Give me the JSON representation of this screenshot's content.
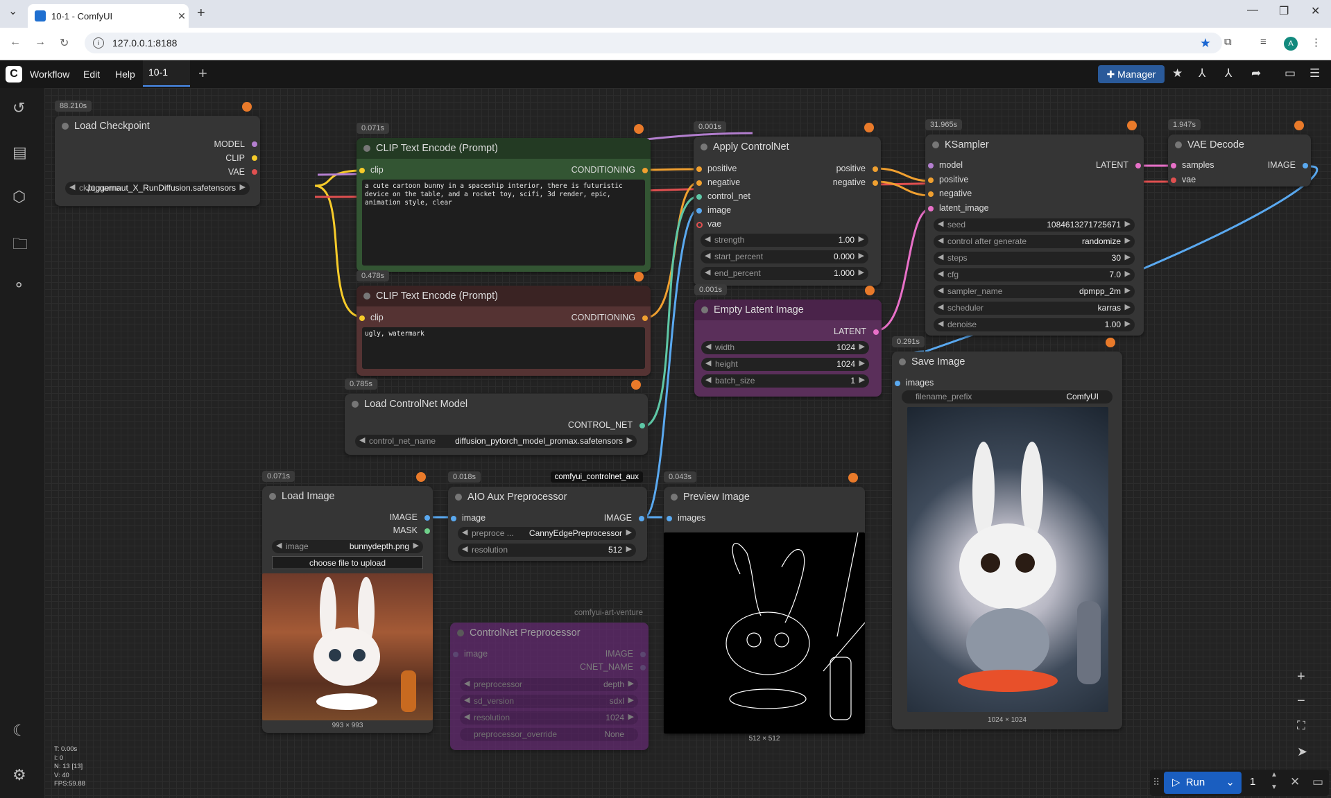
{
  "browser": {
    "tab_title": "10-1 - ComfyUI",
    "url": "127.0.0.1:8188",
    "profile_initial": "A"
  },
  "app": {
    "menus": [
      "Workflow",
      "Edit",
      "Help"
    ],
    "workflow_tab": "10-1",
    "manager_label": "Manager",
    "run_label": "Run",
    "run_count": "1",
    "accent": "#1a5ec0"
  },
  "nodes": {
    "load_checkpoint": {
      "time": "88.210s",
      "title": "Load Checkpoint",
      "outputs": [
        "MODEL",
        "CLIP",
        "VAE"
      ],
      "widget_label": "ckpt_name",
      "widget_value": "Juggernaut_X_RunDiffusion.safetensors"
    },
    "clip_pos": {
      "time": "0.071s",
      "title": "CLIP Text Encode (Prompt)",
      "input": "clip",
      "output": "CONDITIONING",
      "text": "a cute cartoon bunny in a spaceship interior, there is futuristic device on the table, and a rocket toy, scifi, 3d render, epic, animation style, clear"
    },
    "clip_neg": {
      "time": "0.478s",
      "title": "CLIP Text Encode (Prompt)",
      "input": "clip",
      "output": "CONDITIONING",
      "text": "ugly, watermark"
    },
    "apply_controlnet": {
      "time": "0.001s",
      "title": "Apply ControlNet",
      "inputs": [
        "positive",
        "negative",
        "control_net",
        "image",
        "vae"
      ],
      "outputs": [
        "positive",
        "negative"
      ],
      "widgets": [
        {
          "label": "strength",
          "value": "1.00"
        },
        {
          "label": "start_percent",
          "value": "0.000"
        },
        {
          "label": "end_percent",
          "value": "1.000"
        }
      ]
    },
    "empty_latent": {
      "time": "0.001s",
      "title": "Empty Latent Image",
      "output": "LATENT",
      "widgets": [
        {
          "label": "width",
          "value": "1024"
        },
        {
          "label": "height",
          "value": "1024"
        },
        {
          "label": "batch_size",
          "value": "1"
        }
      ]
    },
    "ksampler": {
      "time": "31.965s",
      "title": "KSampler",
      "inputs": [
        "model",
        "positive",
        "negative",
        "latent_image"
      ],
      "output": "LATENT",
      "widgets": [
        {
          "label": "seed",
          "value": "1084613271725671"
        },
        {
          "label": "control after generate",
          "value": "randomize"
        },
        {
          "label": "steps",
          "value": "30"
        },
        {
          "label": "cfg",
          "value": "7.0"
        },
        {
          "label": "sampler_name",
          "value": "dpmpp_2m"
        },
        {
          "label": "scheduler",
          "value": "karras"
        },
        {
          "label": "denoise",
          "value": "1.00"
        }
      ]
    },
    "vae_decode": {
      "time": "1.947s",
      "title": "VAE Decode",
      "inputs": [
        "samples",
        "vae"
      ],
      "output": "IMAGE"
    },
    "save_image": {
      "time": "0.291s",
      "title": "Save Image",
      "input": "images",
      "widget_label": "filename_prefix",
      "widget_value": "ComfyUI",
      "caption": "1024 × 1024"
    },
    "load_controlnet": {
      "time": "0.785s",
      "title": "Load ControlNet Model",
      "output": "CONTROL_NET",
      "widget_label": "control_net_name",
      "widget_value": "diffusion_pytorch_model_promax.safetensors"
    },
    "load_image": {
      "time": "0.071s",
      "title": "Load Image",
      "outputs": [
        "IMAGE",
        "MASK"
      ],
      "widget_label": "image",
      "widget_value": "bunnydepth.png",
      "upload_label": "choose file to upload",
      "caption": "993 × 993"
    },
    "aio_aux": {
      "time": "0.018s",
      "pack": "comfyui_controlnet_aux",
      "title": "AIO Aux Preprocessor",
      "input": "image",
      "output": "IMAGE",
      "widgets": [
        {
          "label": "preproce ...",
          "value": "CannyEdgePreprocessor"
        },
        {
          "label": "resolution",
          "value": "512"
        }
      ]
    },
    "preview_image": {
      "time": "0.043s",
      "title": "Preview Image",
      "input": "images",
      "caption": "512 × 512"
    },
    "controlnet_pre": {
      "pack": "comfyui-art-venture",
      "title": "ControlNet Preprocessor",
      "input": "image",
      "outputs": [
        "IMAGE",
        "CNET_NAME"
      ],
      "widgets": [
        {
          "label": "preprocessor",
          "value": "depth"
        },
        {
          "label": "sd_version",
          "value": "sdxl"
        },
        {
          "label": "resolution",
          "value": "1024"
        },
        {
          "label": "preprocessor_override",
          "value": "None"
        }
      ]
    }
  },
  "stats": [
    "T: 0.00s",
    "I: 0",
    "N: 13 [13]",
    "V: 40",
    "FPS:59.88"
  ]
}
